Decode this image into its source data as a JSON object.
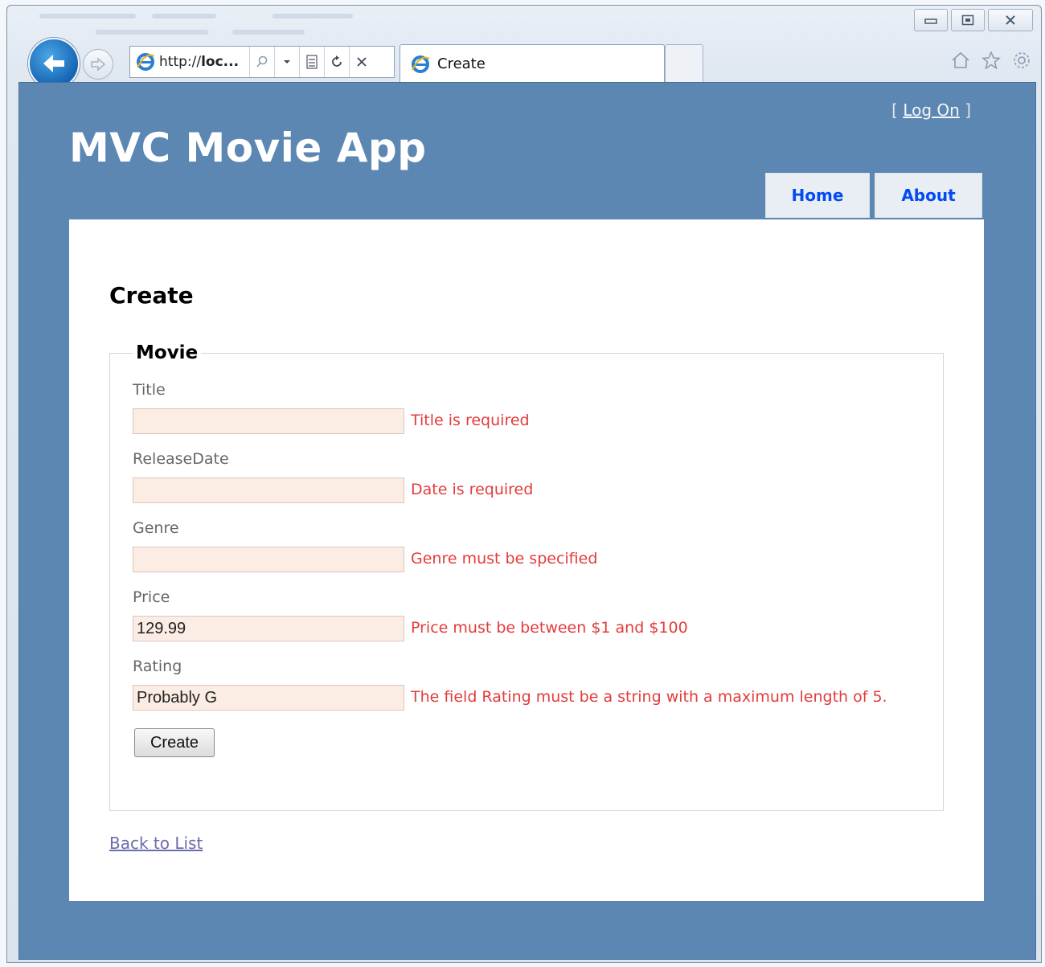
{
  "browser": {
    "address_prefix": "http://",
    "address_host": "loc...",
    "tab_title": "Create"
  },
  "header": {
    "logon_open": "[",
    "logon_label": "Log On",
    "logon_close": "]",
    "app_title": "MVC Movie App"
  },
  "menu": {
    "items": [
      {
        "label": "Home"
      },
      {
        "label": "About"
      }
    ]
  },
  "main": {
    "page_title": "Create",
    "fieldset_legend": "Movie",
    "fields": [
      {
        "label": "Title",
        "value": "",
        "error": "Title is required"
      },
      {
        "label": "ReleaseDate",
        "value": "",
        "error": "Date is required"
      },
      {
        "label": "Genre",
        "value": "",
        "error": "Genre must be specified"
      },
      {
        "label": "Price",
        "value": "129.99",
        "error": "Price must be between $1 and $100"
      },
      {
        "label": "Rating",
        "value": "Probably G",
        "error": "The field Rating must be a string with a maximum length of 5."
      }
    ],
    "create_button": "Create",
    "back_link": "Back to List"
  },
  "colors": {
    "page_background": "#5c87b2",
    "menu_link": "#034af3",
    "error_text": "#e43b3b",
    "invalid_input_background": "#fbece4"
  }
}
